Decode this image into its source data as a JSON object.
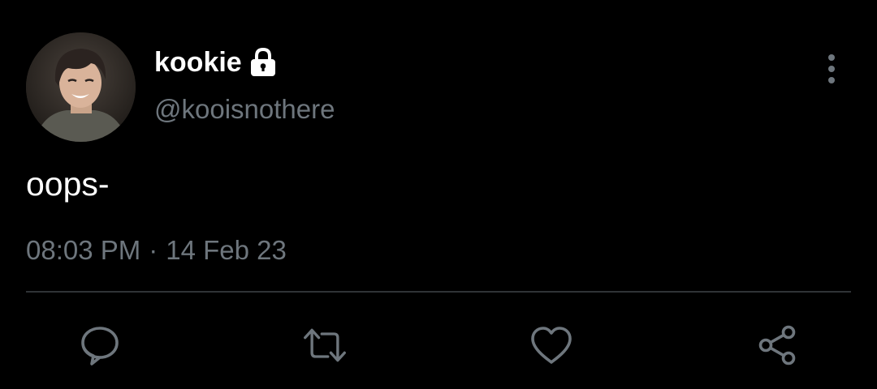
{
  "user": {
    "display_name": "kookie",
    "handle": "@kooisnothere",
    "protected_icon": "lock-icon",
    "avatar": "profile-photo"
  },
  "tweet": {
    "text": "oops-",
    "time": "08:03 PM",
    "separator": "·",
    "date": "14 Feb 23"
  },
  "actions": {
    "reply_icon": "comment-icon",
    "retweet_icon": "retweet-icon",
    "like_icon": "heart-icon",
    "share_icon": "share-icon",
    "more_icon": "more-vertical-icon"
  },
  "colors": {
    "background": "#000000",
    "primary_text": "#ffffff",
    "secondary_text": "#6e767d",
    "divider": "#2f3336",
    "icon": "#6e767d"
  }
}
